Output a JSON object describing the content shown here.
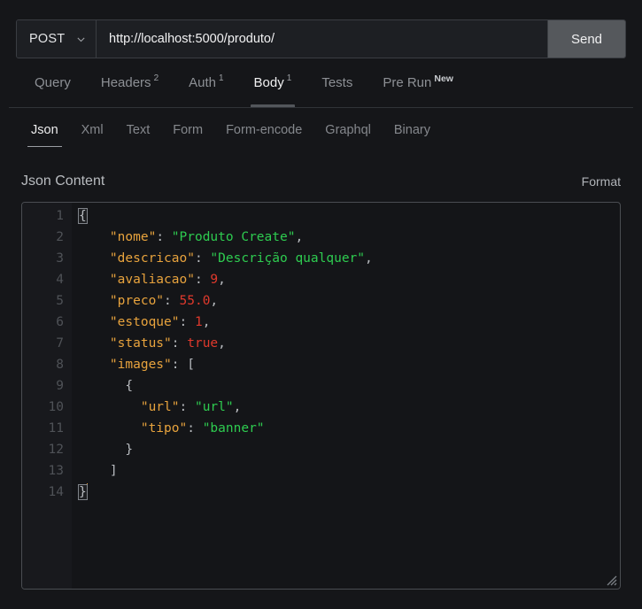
{
  "request_bar": {
    "method": "POST",
    "method_chevron_icon": "chevron-down-icon",
    "url": "http://localhost:5000/produto/",
    "url_placeholder": "Enter request URL",
    "send_label": "Send"
  },
  "main_tabs": [
    {
      "label": "Query",
      "badge": "",
      "active": false
    },
    {
      "label": "Headers",
      "badge": "2",
      "active": false
    },
    {
      "label": "Auth",
      "badge": "1",
      "active": false
    },
    {
      "label": "Body",
      "badge": "1",
      "active": true
    },
    {
      "label": "Tests",
      "badge": "",
      "active": false
    },
    {
      "label": "Pre Run",
      "badge": "New",
      "active": false
    }
  ],
  "body_tabs": [
    {
      "label": "Json",
      "active": true
    },
    {
      "label": "Xml",
      "active": false
    },
    {
      "label": "Text",
      "active": false
    },
    {
      "label": "Form",
      "active": false
    },
    {
      "label": "Form-encode",
      "active": false
    },
    {
      "label": "Graphql",
      "active": false
    },
    {
      "label": "Binary",
      "active": false
    }
  ],
  "section": {
    "title": "Json Content",
    "format_label": "Format"
  },
  "editor": {
    "resize_grip_icon": "resize-grip-icon",
    "line_numbers": [
      "1",
      "2",
      "3",
      "4",
      "5",
      "6",
      "7",
      "8",
      "9",
      "10",
      "11",
      "12",
      "13",
      "14"
    ],
    "json_value": {
      "nome": "Produto Create",
      "descricao": "Descrição qualquer",
      "avaliacao": 9,
      "preco": 55.0,
      "estoque": 1,
      "status": true,
      "images": [
        {
          "url": "url",
          "tipo": "banner"
        }
      ]
    },
    "lines": [
      {
        "n": "1",
        "indent": 0,
        "tokens": [
          {
            "t": "brace",
            "v": "{",
            "bracket": true
          }
        ]
      },
      {
        "n": "2",
        "indent": 2,
        "tokens": [
          {
            "t": "key",
            "v": "\"nome\""
          },
          {
            "t": "punct",
            "v": ": "
          },
          {
            "t": "str",
            "v": "\"Produto Create\""
          },
          {
            "t": "punct",
            "v": ","
          }
        ]
      },
      {
        "n": "3",
        "indent": 2,
        "tokens": [
          {
            "t": "key",
            "v": "\"descricao\""
          },
          {
            "t": "punct",
            "v": ": "
          },
          {
            "t": "str",
            "v": "\"Descrição qualquer\""
          },
          {
            "t": "punct",
            "v": ","
          }
        ]
      },
      {
        "n": "4",
        "indent": 2,
        "tokens": [
          {
            "t": "key",
            "v": "\"avaliacao\""
          },
          {
            "t": "punct",
            "v": ": "
          },
          {
            "t": "num",
            "v": "9"
          },
          {
            "t": "punct",
            "v": ","
          }
        ]
      },
      {
        "n": "5",
        "indent": 2,
        "tokens": [
          {
            "t": "key",
            "v": "\"preco\""
          },
          {
            "t": "punct",
            "v": ": "
          },
          {
            "t": "num",
            "v": "55.0"
          },
          {
            "t": "punct",
            "v": ","
          }
        ]
      },
      {
        "n": "6",
        "indent": 2,
        "tokens": [
          {
            "t": "key",
            "v": "\"estoque\""
          },
          {
            "t": "punct",
            "v": ": "
          },
          {
            "t": "num",
            "v": "1"
          },
          {
            "t": "punct",
            "v": ","
          }
        ]
      },
      {
        "n": "7",
        "indent": 2,
        "tokens": [
          {
            "t": "key",
            "v": "\"status\""
          },
          {
            "t": "punct",
            "v": ": "
          },
          {
            "t": "bool",
            "v": "true"
          },
          {
            "t": "punct",
            "v": ","
          }
        ]
      },
      {
        "n": "8",
        "indent": 2,
        "tokens": [
          {
            "t": "key",
            "v": "\"images\""
          },
          {
            "t": "punct",
            "v": ": "
          },
          {
            "t": "brace",
            "v": "["
          }
        ]
      },
      {
        "n": "9",
        "indent": 3,
        "tokens": [
          {
            "t": "brace",
            "v": "{"
          }
        ]
      },
      {
        "n": "10",
        "indent": 4,
        "tokens": [
          {
            "t": "key",
            "v": "\"url\""
          },
          {
            "t": "punct",
            "v": ": "
          },
          {
            "t": "str",
            "v": "\"url\""
          },
          {
            "t": "punct",
            "v": ","
          }
        ]
      },
      {
        "n": "11",
        "indent": 4,
        "tokens": [
          {
            "t": "key",
            "v": "\"tipo\""
          },
          {
            "t": "punct",
            "v": ": "
          },
          {
            "t": "str",
            "v": "\"banner\""
          }
        ]
      },
      {
        "n": "12",
        "indent": 3,
        "tokens": [
          {
            "t": "brace",
            "v": "}"
          }
        ]
      },
      {
        "n": "13",
        "indent": 2,
        "tokens": [
          {
            "t": "brace",
            "v": "]"
          }
        ]
      },
      {
        "n": "14",
        "indent": 0,
        "tokens": [
          {
            "t": "brace",
            "v": "}",
            "bracket": true,
            "caret": true
          }
        ]
      }
    ]
  },
  "colors": {
    "page_bg": "#151619",
    "editor_bg": "#141518",
    "gutter_bg": "#18191d",
    "border": "#4a4d52",
    "send_bg": "#55585c",
    "key": "#e8a33d",
    "string": "#2ecc50",
    "number": "#e0392c",
    "boolean": "#e0392c",
    "punctuation": "#b9bcc0",
    "active_text": "#f0f0f1",
    "muted_text": "#85888d"
  }
}
